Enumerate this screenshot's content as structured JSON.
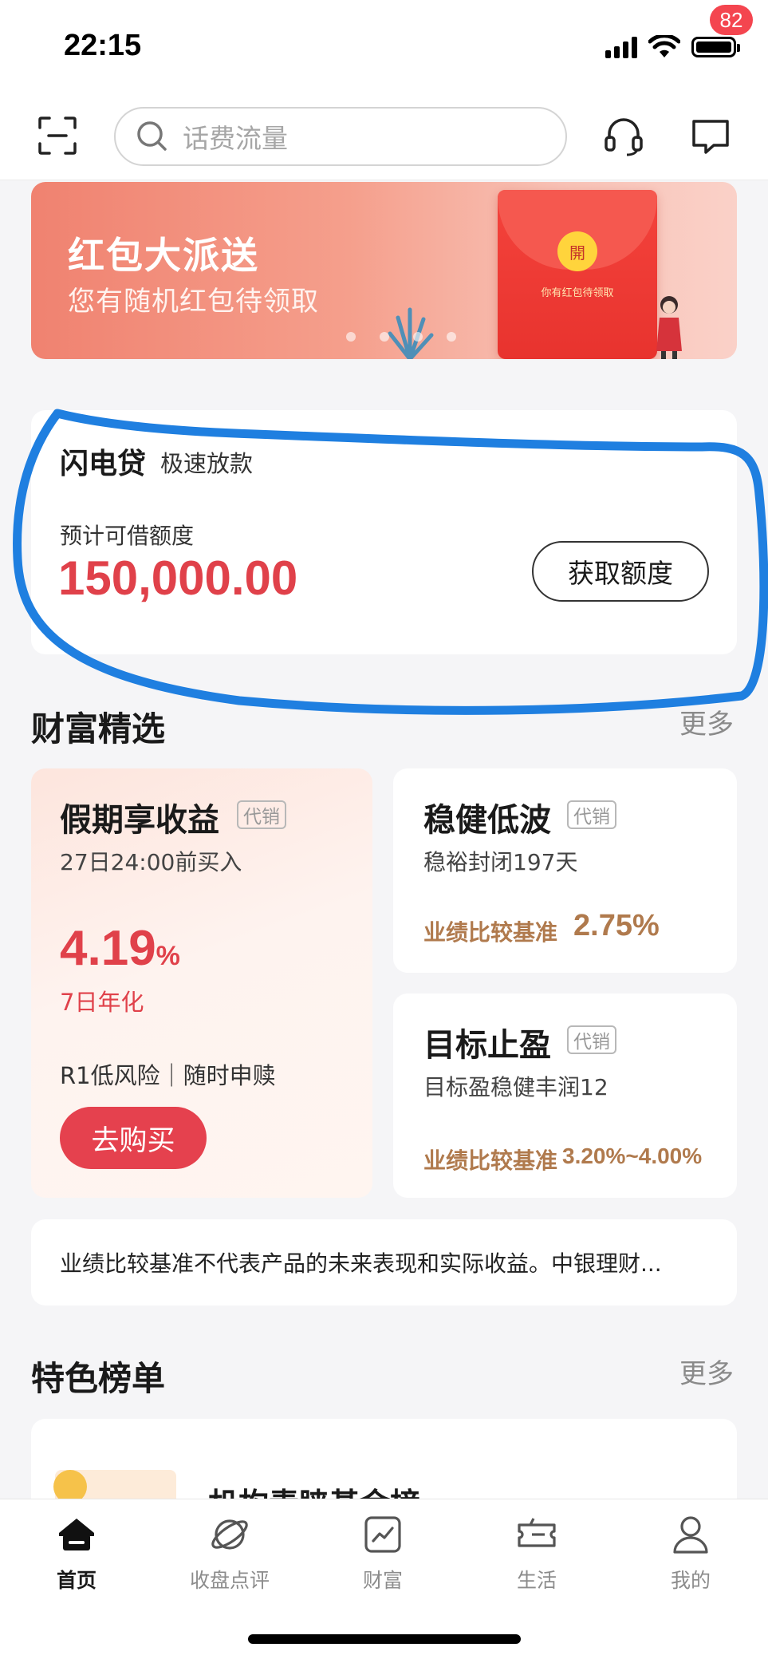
{
  "status_bar": {
    "time": "22:15"
  },
  "header": {
    "search_placeholder": "话费流量",
    "message_badge": "82"
  },
  "banner": {
    "title": "红包大派送",
    "subtitle": "您有随机红包待领取",
    "envelope_seal": "開",
    "envelope_text": "你有红包待领取"
  },
  "loan": {
    "title": "闪电贷",
    "tag": "极速放款",
    "label": "预计可借额度",
    "amount": "150,000.00",
    "button": "获取额度"
  },
  "wealth": {
    "title": "财富精选",
    "more": "更多",
    "featured": {
      "name": "假期享收益",
      "tag": "代销",
      "desc": "27日24:00前买入",
      "rate": "4.19",
      "rate_unit": "%",
      "rate_label": "7日年化",
      "risk": "R1低风险｜随时申赎",
      "button": "去购买"
    },
    "products": [
      {
        "name": "稳健低波",
        "tag": "代销",
        "desc": "稳裕封闭197天",
        "bench_label": "业绩比较基准",
        "bench_value": "2.75%"
      },
      {
        "name": "目标止盈",
        "tag": "代销",
        "desc": "目标盈稳健丰润12",
        "bench_label": "业绩比较基准",
        "bench_value": "3.20%~4.00%"
      }
    ],
    "disclaimer": "业绩比较基准不代表产品的未来表现和实际收益。中银理财..."
  },
  "ranking": {
    "title": "特色榜单",
    "more": "更多",
    "first_item": "机构青睐基金榜"
  },
  "tabbar": {
    "tabs": [
      {
        "label": "首页",
        "icon": "home-icon",
        "active": true
      },
      {
        "label": "收盘点评",
        "icon": "planet-icon",
        "active": false
      },
      {
        "label": "财富",
        "icon": "chart-icon",
        "active": false
      },
      {
        "label": "生活",
        "icon": "ticket-icon",
        "active": false
      },
      {
        "label": "我的",
        "icon": "profile-icon",
        "active": false
      }
    ]
  },
  "colors": {
    "accent_red": "#e0414a",
    "bench_brown": "#b07a4d",
    "annotation_blue": "#1f7fe0"
  }
}
